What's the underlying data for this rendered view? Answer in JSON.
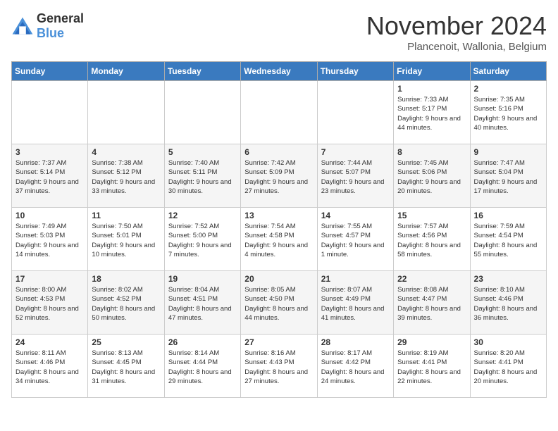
{
  "logo": {
    "text_general": "General",
    "text_blue": "Blue"
  },
  "title": "November 2024",
  "subtitle": "Plancenoit, Wallonia, Belgium",
  "days_of_week": [
    "Sunday",
    "Monday",
    "Tuesday",
    "Wednesday",
    "Thursday",
    "Friday",
    "Saturday"
  ],
  "weeks": [
    [
      {
        "day": "",
        "sunrise": "",
        "sunset": "",
        "daylight": ""
      },
      {
        "day": "",
        "sunrise": "",
        "sunset": "",
        "daylight": ""
      },
      {
        "day": "",
        "sunrise": "",
        "sunset": "",
        "daylight": ""
      },
      {
        "day": "",
        "sunrise": "",
        "sunset": "",
        "daylight": ""
      },
      {
        "day": "",
        "sunrise": "",
        "sunset": "",
        "daylight": ""
      },
      {
        "day": "1",
        "sunrise": "Sunrise: 7:33 AM",
        "sunset": "Sunset: 5:17 PM",
        "daylight": "Daylight: 9 hours and 44 minutes."
      },
      {
        "day": "2",
        "sunrise": "Sunrise: 7:35 AM",
        "sunset": "Sunset: 5:16 PM",
        "daylight": "Daylight: 9 hours and 40 minutes."
      }
    ],
    [
      {
        "day": "3",
        "sunrise": "Sunrise: 7:37 AM",
        "sunset": "Sunset: 5:14 PM",
        "daylight": "Daylight: 9 hours and 37 minutes."
      },
      {
        "day": "4",
        "sunrise": "Sunrise: 7:38 AM",
        "sunset": "Sunset: 5:12 PM",
        "daylight": "Daylight: 9 hours and 33 minutes."
      },
      {
        "day": "5",
        "sunrise": "Sunrise: 7:40 AM",
        "sunset": "Sunset: 5:11 PM",
        "daylight": "Daylight: 9 hours and 30 minutes."
      },
      {
        "day": "6",
        "sunrise": "Sunrise: 7:42 AM",
        "sunset": "Sunset: 5:09 PM",
        "daylight": "Daylight: 9 hours and 27 minutes."
      },
      {
        "day": "7",
        "sunrise": "Sunrise: 7:44 AM",
        "sunset": "Sunset: 5:07 PM",
        "daylight": "Daylight: 9 hours and 23 minutes."
      },
      {
        "day": "8",
        "sunrise": "Sunrise: 7:45 AM",
        "sunset": "Sunset: 5:06 PM",
        "daylight": "Daylight: 9 hours and 20 minutes."
      },
      {
        "day": "9",
        "sunrise": "Sunrise: 7:47 AM",
        "sunset": "Sunset: 5:04 PM",
        "daylight": "Daylight: 9 hours and 17 minutes."
      }
    ],
    [
      {
        "day": "10",
        "sunrise": "Sunrise: 7:49 AM",
        "sunset": "Sunset: 5:03 PM",
        "daylight": "Daylight: 9 hours and 14 minutes."
      },
      {
        "day": "11",
        "sunrise": "Sunrise: 7:50 AM",
        "sunset": "Sunset: 5:01 PM",
        "daylight": "Daylight: 9 hours and 10 minutes."
      },
      {
        "day": "12",
        "sunrise": "Sunrise: 7:52 AM",
        "sunset": "Sunset: 5:00 PM",
        "daylight": "Daylight: 9 hours and 7 minutes."
      },
      {
        "day": "13",
        "sunrise": "Sunrise: 7:54 AM",
        "sunset": "Sunset: 4:58 PM",
        "daylight": "Daylight: 9 hours and 4 minutes."
      },
      {
        "day": "14",
        "sunrise": "Sunrise: 7:55 AM",
        "sunset": "Sunset: 4:57 PM",
        "daylight": "Daylight: 9 hours and 1 minute."
      },
      {
        "day": "15",
        "sunrise": "Sunrise: 7:57 AM",
        "sunset": "Sunset: 4:56 PM",
        "daylight": "Daylight: 8 hours and 58 minutes."
      },
      {
        "day": "16",
        "sunrise": "Sunrise: 7:59 AM",
        "sunset": "Sunset: 4:54 PM",
        "daylight": "Daylight: 8 hours and 55 minutes."
      }
    ],
    [
      {
        "day": "17",
        "sunrise": "Sunrise: 8:00 AM",
        "sunset": "Sunset: 4:53 PM",
        "daylight": "Daylight: 8 hours and 52 minutes."
      },
      {
        "day": "18",
        "sunrise": "Sunrise: 8:02 AM",
        "sunset": "Sunset: 4:52 PM",
        "daylight": "Daylight: 8 hours and 50 minutes."
      },
      {
        "day": "19",
        "sunrise": "Sunrise: 8:04 AM",
        "sunset": "Sunset: 4:51 PM",
        "daylight": "Daylight: 8 hours and 47 minutes."
      },
      {
        "day": "20",
        "sunrise": "Sunrise: 8:05 AM",
        "sunset": "Sunset: 4:50 PM",
        "daylight": "Daylight: 8 hours and 44 minutes."
      },
      {
        "day": "21",
        "sunrise": "Sunrise: 8:07 AM",
        "sunset": "Sunset: 4:49 PM",
        "daylight": "Daylight: 8 hours and 41 minutes."
      },
      {
        "day": "22",
        "sunrise": "Sunrise: 8:08 AM",
        "sunset": "Sunset: 4:47 PM",
        "daylight": "Daylight: 8 hours and 39 minutes."
      },
      {
        "day": "23",
        "sunrise": "Sunrise: 8:10 AM",
        "sunset": "Sunset: 4:46 PM",
        "daylight": "Daylight: 8 hours and 36 minutes."
      }
    ],
    [
      {
        "day": "24",
        "sunrise": "Sunrise: 8:11 AM",
        "sunset": "Sunset: 4:46 PM",
        "daylight": "Daylight: 8 hours and 34 minutes."
      },
      {
        "day": "25",
        "sunrise": "Sunrise: 8:13 AM",
        "sunset": "Sunset: 4:45 PM",
        "daylight": "Daylight: 8 hours and 31 minutes."
      },
      {
        "day": "26",
        "sunrise": "Sunrise: 8:14 AM",
        "sunset": "Sunset: 4:44 PM",
        "daylight": "Daylight: 8 hours and 29 minutes."
      },
      {
        "day": "27",
        "sunrise": "Sunrise: 8:16 AM",
        "sunset": "Sunset: 4:43 PM",
        "daylight": "Daylight: 8 hours and 27 minutes."
      },
      {
        "day": "28",
        "sunrise": "Sunrise: 8:17 AM",
        "sunset": "Sunset: 4:42 PM",
        "daylight": "Daylight: 8 hours and 24 minutes."
      },
      {
        "day": "29",
        "sunrise": "Sunrise: 8:19 AM",
        "sunset": "Sunset: 4:41 PM",
        "daylight": "Daylight: 8 hours and 22 minutes."
      },
      {
        "day": "30",
        "sunrise": "Sunrise: 8:20 AM",
        "sunset": "Sunset: 4:41 PM",
        "daylight": "Daylight: 8 hours and 20 minutes."
      }
    ]
  ]
}
